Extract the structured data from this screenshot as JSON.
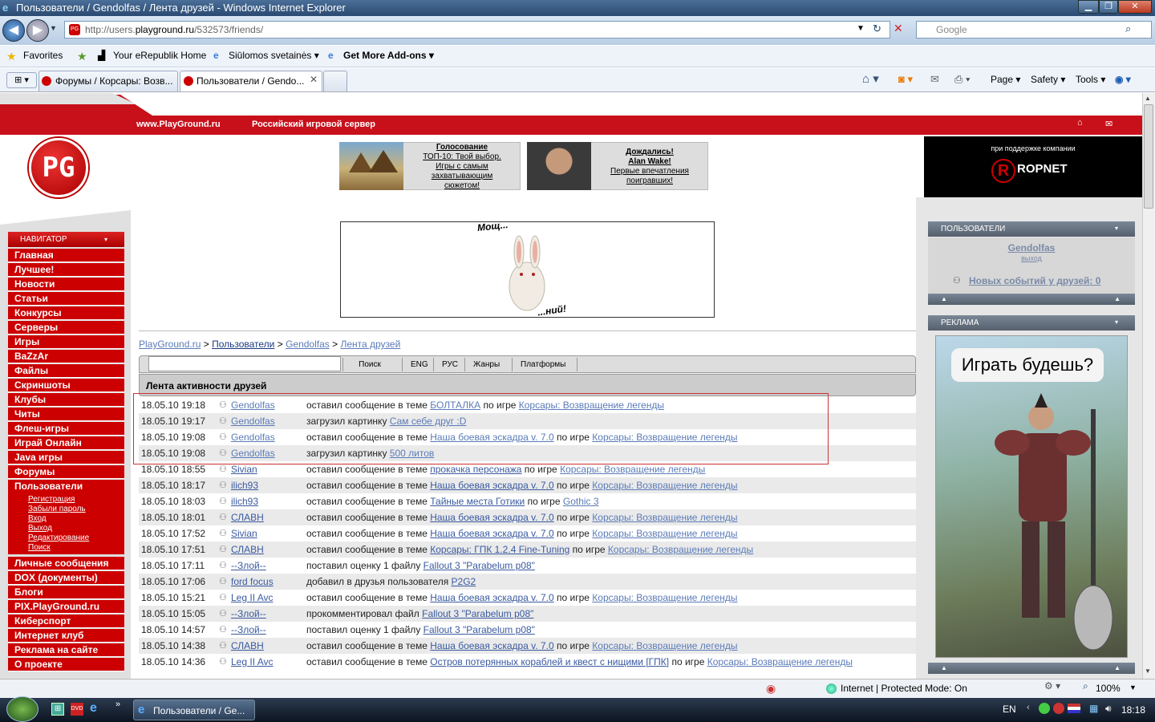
{
  "window": {
    "title": "Пользователи / Gendolfas / Лента друзей - Windows Internet Explorer",
    "url_prefix": "http://users.",
    "url_domain": "playground.ru",
    "url_path": "/532573/friends/",
    "search_placeholder": "Google"
  },
  "favbar": {
    "favorites": "Favorites",
    "items": [
      "Your eRepublik Home",
      "Siūlomos svetainės ▾",
      "Get More Add-ons ▾"
    ]
  },
  "tabs": [
    "Форумы / Корсары: Возв...",
    "Пользователи / Gendo..."
  ],
  "tools": [
    "Page ▾",
    "Safety ▾",
    "Tools ▾"
  ],
  "site": {
    "domain": "www.PlayGround.ru",
    "tagline": "Российский игровой сервер",
    "logo": "PG",
    "promo1": [
      "Голосование",
      "ТОП-10: Твой выбор.",
      "Игры с самым",
      "захватывающим",
      "сюжетом!"
    ],
    "promo2": [
      "Дождались!",
      "Alan Wake!",
      "Первые впечатления",
      "поигравших!"
    ],
    "sponsor_label": "при поддержке компании",
    "sponsor": "ROPNET",
    "banner_text_top": "Мощ...",
    "banner_text_bottom": "...ний!"
  },
  "nav": {
    "header": "НАВИГАТОР",
    "items": [
      "Главная",
      "Лучшее!",
      "Новости",
      "Статьи",
      "Конкурсы",
      "Серверы",
      "Игры",
      "BaZzAr",
      "Файлы",
      "Скриншоты",
      "Клубы",
      "Читы",
      "Флеш-игры",
      "Играй Онлайн",
      "Java игры",
      "Форумы",
      "Пользователи"
    ],
    "sub": [
      "Регистрация",
      "Забыли пароль",
      "Вход",
      "Выход",
      "Редактирование",
      "Поиск"
    ],
    "items2": [
      "Личные сообщения",
      "DOX (документы)",
      "Блоги",
      "PIX.PlayGround.ru",
      "Киберспорт",
      "Интернет клуб",
      "Реклама на сайте",
      "О проекте"
    ]
  },
  "breadcrumb": [
    "PlayGround.ru",
    "Пользователи",
    "Gendolfas",
    "Лента друзей"
  ],
  "toolbar": [
    "Поиск",
    "ENG",
    "РУС",
    "Жанры",
    "Платформы"
  ],
  "feed_title": "Лента активности друзей",
  "feed": [
    {
      "time": "18.05.10 19:18",
      "user": "Gendolfas",
      "action": "оставил сообщение в теме",
      "target": "БОЛТАЛКА",
      "game_prefix": "по игре",
      "game": "Корсары: Возвращение легенды"
    },
    {
      "time": "18.05.10 19:17",
      "user": "Gendolfas",
      "action": "загрузил картинку",
      "target": "Сам себе друг :D",
      "game_prefix": "",
      "game": ""
    },
    {
      "time": "18.05.10 19:08",
      "user": "Gendolfas",
      "action": "оставил сообщение в теме",
      "target": "Наша боевая эскадра v. 7.0",
      "game_prefix": "по игре",
      "game": "Корсары: Возвращение легенды"
    },
    {
      "time": "18.05.10 19:08",
      "user": "Gendolfas",
      "action": "загрузил картинку",
      "target": "500 литов",
      "game_prefix": "",
      "game": ""
    },
    {
      "time": "18.05.10 18:55",
      "user": "Sivian",
      "action": "оставил сообщение в теме",
      "target": "прокачка персонажа",
      "game_prefix": "по игре",
      "game": "Корсары: Возвращение легенды"
    },
    {
      "time": "18.05.10 18:17",
      "user": "ilich93",
      "action": "оставил сообщение в теме",
      "target": "Наша боевая эскадра v. 7.0",
      "game_prefix": "по игре",
      "game": "Корсары: Возвращение легенды"
    },
    {
      "time": "18.05.10 18:03",
      "user": "ilich93",
      "action": "оставил сообщение в теме",
      "target": "Тайные места Готики",
      "game_prefix": "по игре",
      "game": "Gothic 3"
    },
    {
      "time": "18.05.10 18:01",
      "user": "СЛАВН",
      "action": "оставил сообщение в теме",
      "target": "Наша боевая эскадра v. 7.0",
      "game_prefix": "по игре",
      "game": "Корсары: Возвращение легенды"
    },
    {
      "time": "18.05.10 17:52",
      "user": "Sivian",
      "action": "оставил сообщение в теме",
      "target": "Наша боевая эскадра v. 7.0",
      "game_prefix": "по игре",
      "game": "Корсары: Возвращение легенды"
    },
    {
      "time": "18.05.10 17:51",
      "user": "СЛАВН",
      "action": "оставил сообщение в теме",
      "target": "Корсары: ГПК 1.2.4 Fine-Tuning",
      "game_prefix": "по игре",
      "game": "Корсары: Возвращение легенды"
    },
    {
      "time": "18.05.10 17:11",
      "user": "--Злой--",
      "action": "поставил оценку 1 файлу",
      "target": "Fallout 3 \"Parabelum p08\"",
      "game_prefix": "",
      "game": ""
    },
    {
      "time": "18.05.10 17:06",
      "user": "ford focus",
      "action": "добавил в друзья пользователя",
      "target": "P2G2",
      "game_prefix": "",
      "game": ""
    },
    {
      "time": "18.05.10 15:21",
      "user": "Leg II Avc",
      "action": "оставил сообщение в теме",
      "target": "Наша боевая эскадра v. 7.0",
      "game_prefix": "по игре",
      "game": "Корсары: Возвращение легенды"
    },
    {
      "time": "18.05.10 15:05",
      "user": "--Злой--",
      "action": "прокомментировал файл",
      "target": "Fallout 3 \"Parabelum p08\"",
      "game_prefix": "",
      "game": ""
    },
    {
      "time": "18.05.10 14:57",
      "user": "--Злой--",
      "action": "поставил оценку 1 файлу",
      "target": "Fallout 3 \"Parabelum p08\"",
      "game_prefix": "",
      "game": ""
    },
    {
      "time": "18.05.10 14:38",
      "user": "СЛАВН",
      "action": "оставил сообщение в теме",
      "target": "Наша боевая эскадра v. 7.0",
      "game_prefix": "по игре",
      "game": "Корсары: Возвращение легенды"
    },
    {
      "time": "18.05.10 14:36",
      "user": "Leg II Avc",
      "action": "оставил сообщение в теме",
      "target": "Остров потерянных кораблей и квест с нищими [ГПК]",
      "game_prefix": "по игре",
      "game": "Корсары: Возвращение легенды"
    }
  ],
  "right": {
    "users_header": "ПОЛЬЗОВАТЕЛИ",
    "username": "Gendolfas",
    "logout": "выход",
    "new_events": "Новых событий у друзей: 0",
    "ad_header": "РЕКЛАМА",
    "ad_text": "Играть будешь?"
  },
  "status": {
    "zone": "Internet | Protected Mode: On",
    "zoom": "100%"
  },
  "taskbar": {
    "item": "Пользователи / Ge...",
    "lang": "EN",
    "clock": "18:18"
  }
}
